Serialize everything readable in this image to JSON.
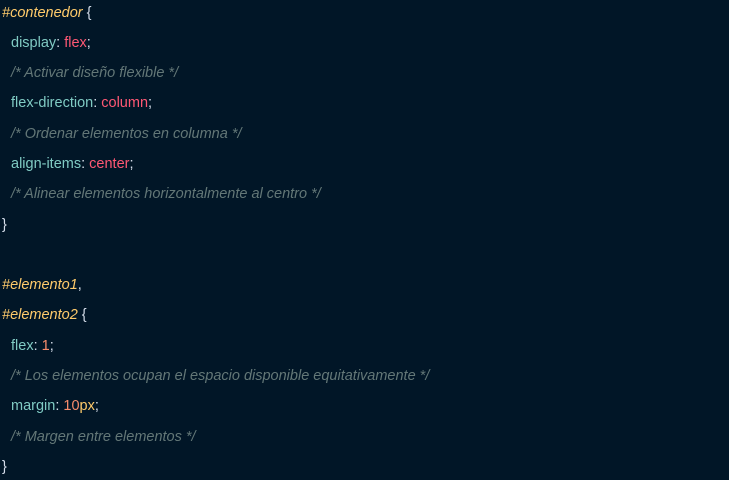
{
  "code": {
    "selector_contenedor": "#contenedor",
    "brace_open": " {",
    "display_prop": "display",
    "display_value": "flex",
    "comment_display": "/* Activar diseño flexible */",
    "direction_prop": "flex-direction",
    "direction_value": "column",
    "comment_direction": "/* Ordenar elementos en columna */",
    "align_prop": "align-items",
    "align_value": "center",
    "comment_align": "/* Alinear elementos horizontalmente al centro */",
    "brace_close": "}",
    "selector_elemento1": "#elemento1",
    "selector_elemento2": "#elemento2",
    "flex_prop": "flex",
    "flex_value": "1",
    "comment_flex": "/* Los elementos ocupan el espacio disponible equitativamente */",
    "margin_prop": "margin",
    "margin_number": "10",
    "margin_unit": "px",
    "comment_margin": "/* Margen entre elementos */"
  },
  "colors": {
    "background": "#011627",
    "selector": "#ffcb6b",
    "property": "#80cbc4",
    "value": "#ff5874",
    "number": "#f78c6c",
    "comment": "#637777"
  }
}
